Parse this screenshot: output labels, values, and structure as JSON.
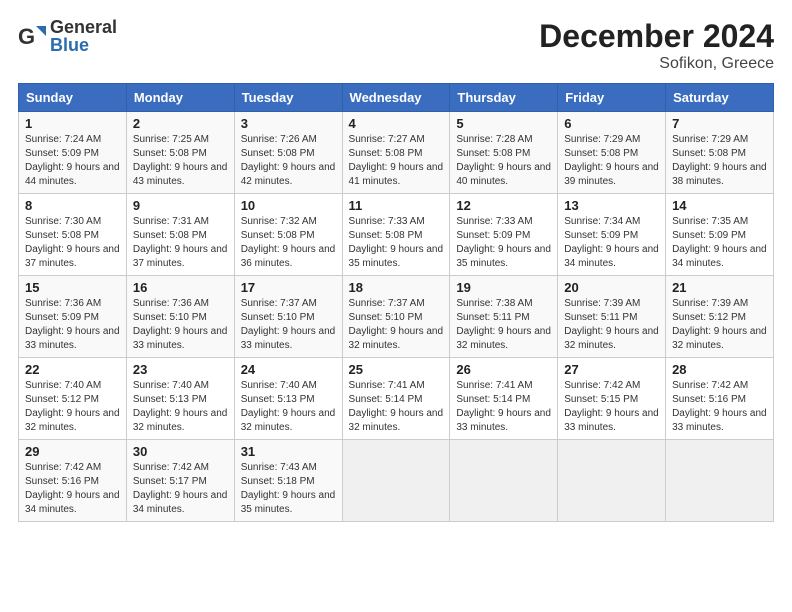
{
  "logo": {
    "general": "General",
    "blue": "Blue"
  },
  "title": "December 2024",
  "subtitle": "Sofikon, Greece",
  "weekdays": [
    "Sunday",
    "Monday",
    "Tuesday",
    "Wednesday",
    "Thursday",
    "Friday",
    "Saturday"
  ],
  "weeks": [
    [
      {
        "day": "1",
        "sunrise": "7:24 AM",
        "sunset": "5:09 PM",
        "daylight": "9 hours and 44 minutes."
      },
      {
        "day": "2",
        "sunrise": "7:25 AM",
        "sunset": "5:08 PM",
        "daylight": "9 hours and 43 minutes."
      },
      {
        "day": "3",
        "sunrise": "7:26 AM",
        "sunset": "5:08 PM",
        "daylight": "9 hours and 42 minutes."
      },
      {
        "day": "4",
        "sunrise": "7:27 AM",
        "sunset": "5:08 PM",
        "daylight": "9 hours and 41 minutes."
      },
      {
        "day": "5",
        "sunrise": "7:28 AM",
        "sunset": "5:08 PM",
        "daylight": "9 hours and 40 minutes."
      },
      {
        "day": "6",
        "sunrise": "7:29 AM",
        "sunset": "5:08 PM",
        "daylight": "9 hours and 39 minutes."
      },
      {
        "day": "7",
        "sunrise": "7:29 AM",
        "sunset": "5:08 PM",
        "daylight": "9 hours and 38 minutes."
      }
    ],
    [
      {
        "day": "8",
        "sunrise": "7:30 AM",
        "sunset": "5:08 PM",
        "daylight": "9 hours and 37 minutes."
      },
      {
        "day": "9",
        "sunrise": "7:31 AM",
        "sunset": "5:08 PM",
        "daylight": "9 hours and 37 minutes."
      },
      {
        "day": "10",
        "sunrise": "7:32 AM",
        "sunset": "5:08 PM",
        "daylight": "9 hours and 36 minutes."
      },
      {
        "day": "11",
        "sunrise": "7:33 AM",
        "sunset": "5:08 PM",
        "daylight": "9 hours and 35 minutes."
      },
      {
        "day": "12",
        "sunrise": "7:33 AM",
        "sunset": "5:09 PM",
        "daylight": "9 hours and 35 minutes."
      },
      {
        "day": "13",
        "sunrise": "7:34 AM",
        "sunset": "5:09 PM",
        "daylight": "9 hours and 34 minutes."
      },
      {
        "day": "14",
        "sunrise": "7:35 AM",
        "sunset": "5:09 PM",
        "daylight": "9 hours and 34 minutes."
      }
    ],
    [
      {
        "day": "15",
        "sunrise": "7:36 AM",
        "sunset": "5:09 PM",
        "daylight": "9 hours and 33 minutes."
      },
      {
        "day": "16",
        "sunrise": "7:36 AM",
        "sunset": "5:10 PM",
        "daylight": "9 hours and 33 minutes."
      },
      {
        "day": "17",
        "sunrise": "7:37 AM",
        "sunset": "5:10 PM",
        "daylight": "9 hours and 33 minutes."
      },
      {
        "day": "18",
        "sunrise": "7:37 AM",
        "sunset": "5:10 PM",
        "daylight": "9 hours and 32 minutes."
      },
      {
        "day": "19",
        "sunrise": "7:38 AM",
        "sunset": "5:11 PM",
        "daylight": "9 hours and 32 minutes."
      },
      {
        "day": "20",
        "sunrise": "7:39 AM",
        "sunset": "5:11 PM",
        "daylight": "9 hours and 32 minutes."
      },
      {
        "day": "21",
        "sunrise": "7:39 AM",
        "sunset": "5:12 PM",
        "daylight": "9 hours and 32 minutes."
      }
    ],
    [
      {
        "day": "22",
        "sunrise": "7:40 AM",
        "sunset": "5:12 PM",
        "daylight": "9 hours and 32 minutes."
      },
      {
        "day": "23",
        "sunrise": "7:40 AM",
        "sunset": "5:13 PM",
        "daylight": "9 hours and 32 minutes."
      },
      {
        "day": "24",
        "sunrise": "7:40 AM",
        "sunset": "5:13 PM",
        "daylight": "9 hours and 32 minutes."
      },
      {
        "day": "25",
        "sunrise": "7:41 AM",
        "sunset": "5:14 PM",
        "daylight": "9 hours and 32 minutes."
      },
      {
        "day": "26",
        "sunrise": "7:41 AM",
        "sunset": "5:14 PM",
        "daylight": "9 hours and 33 minutes."
      },
      {
        "day": "27",
        "sunrise": "7:42 AM",
        "sunset": "5:15 PM",
        "daylight": "9 hours and 33 minutes."
      },
      {
        "day": "28",
        "sunrise": "7:42 AM",
        "sunset": "5:16 PM",
        "daylight": "9 hours and 33 minutes."
      }
    ],
    [
      {
        "day": "29",
        "sunrise": "7:42 AM",
        "sunset": "5:16 PM",
        "daylight": "9 hours and 34 minutes."
      },
      {
        "day": "30",
        "sunrise": "7:42 AM",
        "sunset": "5:17 PM",
        "daylight": "9 hours and 34 minutes."
      },
      {
        "day": "31",
        "sunrise": "7:43 AM",
        "sunset": "5:18 PM",
        "daylight": "9 hours and 35 minutes."
      },
      null,
      null,
      null,
      null
    ]
  ]
}
